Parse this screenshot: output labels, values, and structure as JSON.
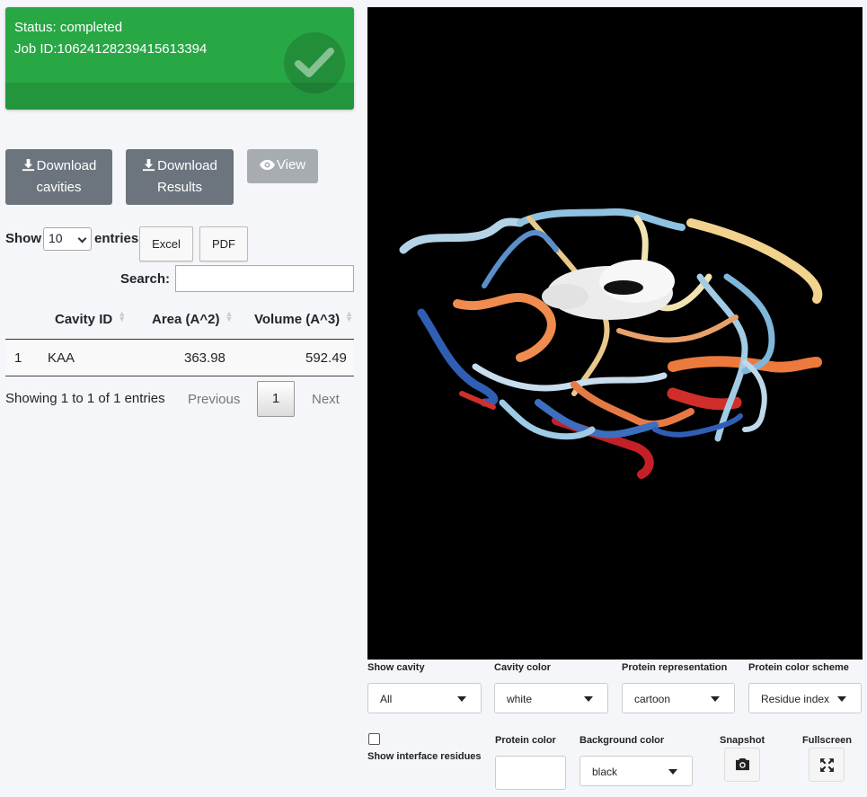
{
  "status": {
    "status_line": "Status: completed",
    "job_line": "Job ID:10624128239415613394",
    "color": "#28a745"
  },
  "actions": {
    "download_cavities_l1": "Download",
    "download_cavities_l2": "cavities",
    "download_results_l1": "Download",
    "download_results_l2": "Results",
    "view_label": "View"
  },
  "table_controls": {
    "show_label": "Show",
    "length_value": "10",
    "entries_label": "entries",
    "excel_label": "Excel",
    "pdf_label": "PDF",
    "search_label": "Search:",
    "search_value": ""
  },
  "table": {
    "headers": [
      "Cavity ID",
      "Area (A^2)",
      "Volume (A^3)"
    ],
    "rows": [
      {
        "index": "1",
        "cavity_id": "KAA",
        "area": "363.98",
        "volume": "592.49"
      }
    ]
  },
  "pagination": {
    "info": "Showing 1 to 1 of 1 entries",
    "previous": "Previous",
    "page": "1",
    "next": "Next"
  },
  "viewer_controls": {
    "show_cavity_label": "Show cavity",
    "show_cavity_value": "All",
    "cavity_color_label": "Cavity color",
    "cavity_color_value": "white",
    "protein_repr_label": "Protein representation",
    "protein_repr_value": "cartoon",
    "protein_scheme_label": "Protein color scheme",
    "protein_scheme_value": "Residue index",
    "interface_label": "Show interface residues",
    "protein_color_label": "Protein color",
    "bg_color_label": "Background color",
    "bg_color_value": "black",
    "snapshot_label": "Snapshot",
    "fullscreen_label": "Fullscreen"
  }
}
